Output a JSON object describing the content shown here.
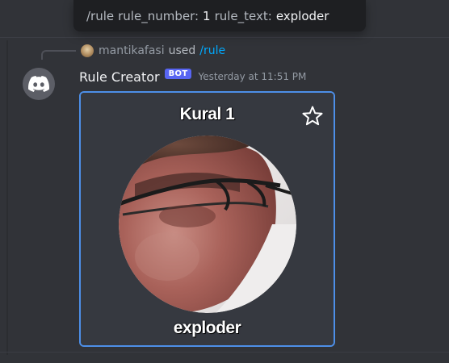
{
  "tooltip": {
    "command": "/rule",
    "param1_name": "rule_number:",
    "param1_value": "1",
    "param2_name": "rule_text:",
    "param2_value": "exploder"
  },
  "command_ref": {
    "user": "mantikafasi",
    "used": "used",
    "command": "/rule"
  },
  "message": {
    "author": "Rule Creator",
    "badge": "BOT",
    "timestamp": "Yesterday at 11:51 PM"
  },
  "embed": {
    "title": "Kural 1",
    "text": "exploder",
    "icons": {
      "star": "star-icon",
      "bot_avatar": "discord-logo-icon"
    }
  },
  "colors": {
    "background": "#313338",
    "accent_border": "#4d8fe8",
    "bot_badge": "#5865f2",
    "command_link": "#00a8fc"
  }
}
